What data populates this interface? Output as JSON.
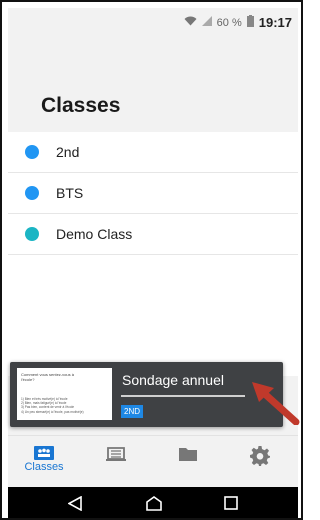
{
  "status": {
    "indicators": "60 %",
    "time": "19:17"
  },
  "header": {
    "title": "Classes"
  },
  "classes": [
    {
      "name": "2nd",
      "color": "#2196f3"
    },
    {
      "name": "BTS",
      "color": "#2196f3"
    },
    {
      "name": "Demo Class",
      "color": "#1bb5c4"
    }
  ],
  "popup": {
    "title": "Sondage annuel",
    "badge": "2ND",
    "progress_fraction": 0.0,
    "thumbnail": {
      "question": "Comment vous sentez-vous à l'école?",
      "options": [
        "1) Bien et très motivé(e) à l'école",
        "2) Bien, mais fatigué(e) à l'école",
        "3) Pas bien, content de venir à l'école",
        "4) Un peu stressé(e) à l'école, pas motivé(e)"
      ]
    }
  },
  "tabs": [
    {
      "id": "classes",
      "label": "Classes",
      "icon": "classes-icon",
      "active": true
    },
    {
      "id": "library",
      "label": "",
      "icon": "library-icon",
      "active": false
    },
    {
      "id": "folders",
      "label": "",
      "icon": "folder-icon",
      "active": false
    },
    {
      "id": "settings",
      "label": "",
      "icon": "gear-icon",
      "active": false
    }
  ],
  "colors": {
    "accent": "#1976d2",
    "popup_bg": "#3f4144",
    "annotation_arrow": "#c0392b"
  },
  "navbar": {
    "icons": [
      "back-icon",
      "home-icon",
      "recents-icon"
    ]
  }
}
